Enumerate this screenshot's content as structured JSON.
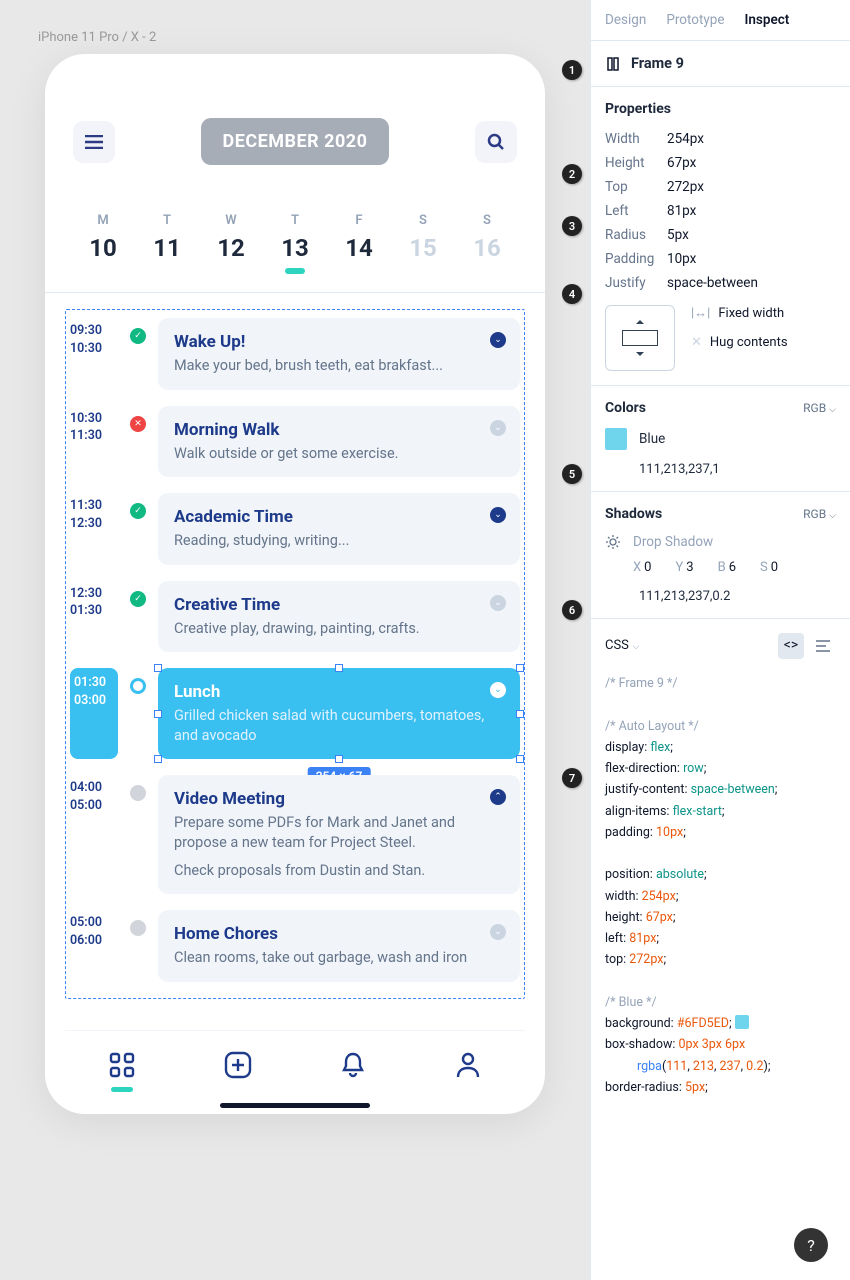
{
  "breadcrumb": "iPhone 11 Pro / X - 2",
  "month_label": "DECEMBER 2020",
  "days": [
    {
      "dow": "M",
      "num": "10",
      "state": ""
    },
    {
      "dow": "T",
      "num": "11",
      "state": ""
    },
    {
      "dow": "W",
      "num": "12",
      "state": ""
    },
    {
      "dow": "T",
      "num": "13",
      "state": "sel"
    },
    {
      "dow": "F",
      "num": "14",
      "state": ""
    },
    {
      "dow": "S",
      "num": "15",
      "state": "muted"
    },
    {
      "dow": "S",
      "num": "16",
      "state": "muted"
    }
  ],
  "events": [
    {
      "t1": "09:30",
      "t2": "10:30",
      "dot": "green",
      "title": "Wake Up!",
      "desc": "Make your bed, brush teeth, eat brakfast...",
      "chev": "blue"
    },
    {
      "t1": "10:30",
      "t2": "11:30",
      "dot": "red",
      "title": "Morning Walk",
      "desc": "Walk outside or get some exercise.",
      "chev": "grey"
    },
    {
      "t1": "11:30",
      "t2": "12:30",
      "dot": "green",
      "title": "Academic Time",
      "desc": "Reading, studying, writing...",
      "chev": "blue"
    },
    {
      "t1": "12:30",
      "t2": "01:30",
      "dot": "green",
      "title": "Creative Time",
      "desc": "Creative play, drawing, painting, crafts.",
      "chev": "grey"
    },
    {
      "t1": "01:30",
      "t2": "03:00",
      "dot": "ring",
      "title": "Lunch",
      "desc": "Grilled chicken salad with cucumbers, tomatoes, and avocado",
      "chev": "white",
      "selected": true
    },
    {
      "t1": "04:00",
      "t2": "05:00",
      "dot": "grey",
      "title": "Video Meeting",
      "desc": "Prepare some PDFs for Mark and Janet and propose a new team for Project Steel.",
      "desc2": "Check proposals from Dustin and Stan.",
      "chev": "blue"
    },
    {
      "t1": "05:00",
      "t2": "06:00",
      "dot": "grey",
      "title": "Home Chores",
      "desc": "Clean rooms, take out garbage, wash and iron",
      "chev": "grey"
    }
  ],
  "dim_label": "254 × 67",
  "panel": {
    "tabs": [
      "Design",
      "Prototype",
      "Inspect"
    ],
    "active_tab": "Inspect",
    "frame": "Frame 9",
    "props_title": "Properties",
    "props": [
      {
        "k": "Width",
        "v": "254px"
      },
      {
        "k": "Height",
        "v": "67px"
      },
      {
        "k": "Top",
        "v": "272px"
      },
      {
        "k": "Left",
        "v": "81px"
      },
      {
        "k": "Radius",
        "v": "5px"
      },
      {
        "k": "Padding",
        "v": "10px"
      },
      {
        "k": "Justify",
        "v": "space-between"
      }
    ],
    "constraint1": "Fixed width",
    "constraint2": "Hug contents",
    "colors_title": "Colors",
    "color_mode": "RGB",
    "color_name": "Blue",
    "color_value": "111,213,237,1",
    "shadows_title": "Shadows",
    "shadow_name": "Drop Shadow",
    "shadow": {
      "x": "0",
      "y": "3",
      "b": "6",
      "s": "0"
    },
    "shadow_color": "111,213,237,0.2",
    "lang": "CSS"
  },
  "code": {
    "c1": "/* Frame 9 */",
    "c2": "/* Auto Layout */",
    "l1a": "display: ",
    "l1b": "flex",
    "l1c": ";",
    "l2a": "flex-direction: ",
    "l2b": "row",
    "l2c": ";",
    "l3a": "justify-content: ",
    "l3b": "space-between",
    "l3c": ";",
    "l4a": "align-items: ",
    "l4b": "flex-start",
    "l4c": ";",
    "l5a": "padding: ",
    "l5b": "10px",
    "l5c": ";",
    "l6a": "position: ",
    "l6b": "absolute",
    "l6c": ";",
    "l7a": "width: ",
    "l7b": "254px",
    "l7c": ";",
    "l8a": "height: ",
    "l8b": "67px",
    "l8c": ";",
    "l9a": "left: ",
    "l9b": "81px",
    "l9c": ";",
    "l10a": "top: ",
    "l10b": "272px",
    "l10c": ";",
    "c3": "/* Blue */",
    "l11a": "background: ",
    "l11b": "#6FD5ED",
    "l11c": "; ",
    "l12a": "box-shadow: ",
    "l12b": "0px 3px 6px",
    "l12c": "rgba",
    "l12d": "(",
    "l12e": "111",
    "l12f": ", ",
    "l12g": "213",
    "l12h": ", ",
    "l12i": "237",
    "l12j": ", ",
    "l12k": "0.2",
    "l12l": ");",
    "l13a": "border-radius: ",
    "l13b": "5px",
    "l13c": ";"
  },
  "annotations": [
    "1",
    "2",
    "3",
    "4",
    "5",
    "6",
    "7"
  ]
}
